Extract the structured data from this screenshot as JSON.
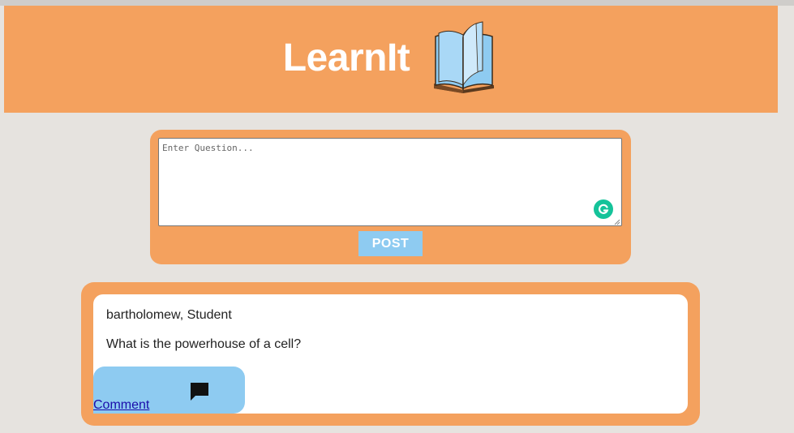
{
  "header": {
    "title": "LearnIt",
    "logo_icon": "open-book-icon",
    "background": "#f4a15e"
  },
  "question_form": {
    "placeholder": "Enter Question...",
    "value": "",
    "post_label": "POST",
    "grammar_icon": "grammarly-icon",
    "post_button_color": "#8ecbf1"
  },
  "posts": [
    {
      "author": "bartholomew, Student",
      "question": "What is the powerhouse of a cell?",
      "comment_label": "Comment",
      "comment_icon": "chat-bubble-icon"
    }
  ],
  "colors": {
    "accent": "#f4a15e",
    "button": "#8ecbf1",
    "page_background": "#e6e3df"
  }
}
